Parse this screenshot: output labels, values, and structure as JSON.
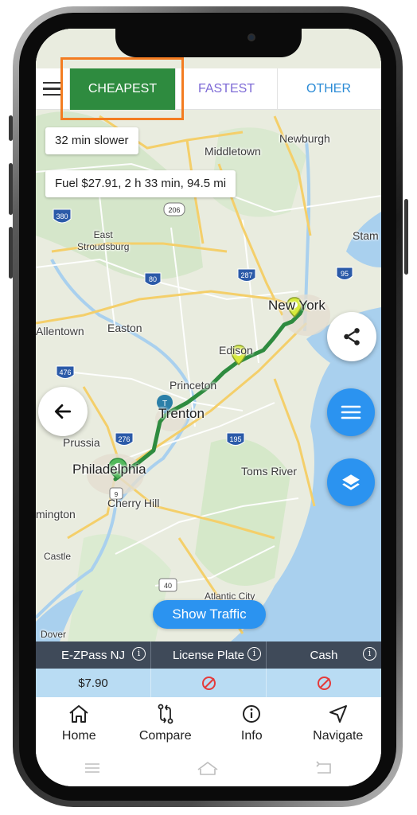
{
  "tabs": {
    "cheapest": "CHEAPEST",
    "fastest": "FASTEST",
    "other": "OTHER",
    "active": "cheapest"
  },
  "route_info": {
    "delay": "32 min slower",
    "summary": "Fuel $27.91, 2 h 33 min, 94.5 mi"
  },
  "map": {
    "labels": {
      "newburgh": "Newburgh",
      "middletown": "Middletown",
      "east_stroudsburg": "East\nStroudsburg",
      "stam": "Stam",
      "new_york": "New York",
      "allentown": "Allentown",
      "easton": "Easton",
      "edison": "Edison",
      "princeton": "Princeton",
      "trenton": "Trenton",
      "prussia": "Prussia",
      "philadelphia": "Philadelphia",
      "toms_river": "Toms River",
      "cherry_hill": "Cherry Hill",
      "mington": "mington",
      "castle": "Castle",
      "atlantic_city": "Atlantic City",
      "dover": "Dover"
    },
    "shields": [
      "380",
      "206",
      "80",
      "287",
      "95",
      "476",
      "276",
      "195",
      "40",
      "9"
    ]
  },
  "buttons": {
    "show_traffic": "Show Traffic"
  },
  "toll_table": {
    "headers": [
      "E-ZPass NJ",
      "License Plate",
      "Cash"
    ],
    "values": [
      "$7.90",
      "",
      ""
    ]
  },
  "bottom_nav": {
    "home": "Home",
    "compare": "Compare",
    "info": "Info",
    "navigate": "Navigate"
  },
  "colors": {
    "route": "#2e8b3f",
    "active_tab": "#2e8b3f",
    "fastest_tab": "#7d6ad6",
    "other_tab": "#2b8bd6",
    "fab_blue": "#2b93f0",
    "highlight": "#f37c21",
    "toll_header": "#3f4a59",
    "toll_row": "#b9dcf3"
  }
}
